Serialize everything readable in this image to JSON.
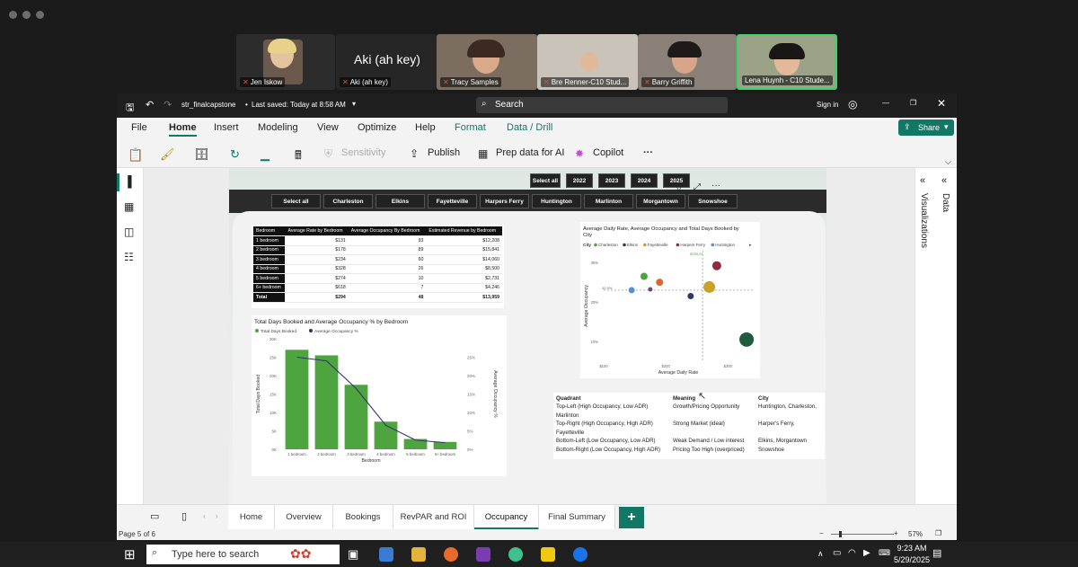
{
  "meeting": {
    "participants": [
      {
        "name": "Jen Iskow"
      },
      {
        "name": "Aki (ah key)",
        "big_label": "Aki (ah key)"
      },
      {
        "name": "Tracy Samples"
      },
      {
        "name": "Bre Renner-C10 Stud..."
      },
      {
        "name": "Barry Griffith"
      },
      {
        "name": "Lena Huynh - C10 Stude..."
      }
    ]
  },
  "app": {
    "file_title": "str_finalcapstone",
    "saved": "Last saved: Today at 8:58 AM",
    "search_placeholder": "Search",
    "sign_in": "Sign in",
    "menu": [
      "File",
      "Home",
      "Insert",
      "Modeling",
      "View",
      "Optimize",
      "Help",
      "Format",
      "Data / Drill"
    ],
    "share": "Share",
    "ribbon": {
      "sensitivity": "Sensitivity",
      "publish": "Publish",
      "prep": "Prep data for AI",
      "copilot": "Copilot",
      "more": "···"
    },
    "right_panes": [
      "Visualizations",
      "Data"
    ],
    "accent": "#117865"
  },
  "report": {
    "year_slicer": [
      "Select all",
      "2022",
      "2023",
      "2024",
      "2025"
    ],
    "city_slicer": [
      "Select all",
      "Charleston",
      "Elkins",
      "Fayetteville",
      "Harpers Ferry",
      "Huntington",
      "Marlinton",
      "Morgantown",
      "Snowshoe"
    ],
    "table": {
      "headers": [
        "Bedroom",
        "Average Rate by Bedroom",
        "Average Occupancy By Bedroom",
        "Estimated Revenue by Bedroom"
      ],
      "rows": [
        [
          "1 bedroom",
          "$131",
          "93",
          "$12,208"
        ],
        [
          "2 bedroom",
          "$178",
          "89",
          "$15,841"
        ],
        [
          "3 bedroom",
          "$234",
          "60",
          "$14,060"
        ],
        [
          "4 bedroom",
          "$328",
          "26",
          "$8,500"
        ],
        [
          "5 bedroom",
          "$274",
          "10",
          "$2,731"
        ],
        [
          "6+ bedroom",
          "$618",
          "7",
          "$4,246"
        ]
      ],
      "total": [
        "Total",
        "$294",
        "48",
        "$13,959"
      ]
    },
    "legend_table": {
      "headers": [
        "Quadrant",
        "Meaning",
        "City"
      ],
      "rows": [
        [
          "Top-Left (High Occupancy, Low ADR)",
          "Growth/Pricing Opportunity",
          "Huntington, Charleston,"
        ],
        [
          "Marlinton",
          "",
          ""
        ],
        [
          "Top-Right (High Occupancy, High ADR)",
          "Strong Market (ideal)",
          "Harper's Ferry,"
        ],
        [
          "Fayetteville",
          "",
          ""
        ],
        [
          "Bottom-Left (Low Occupancy, Low ADR)",
          "Weak Demand / Low interest",
          "Elkins, Morgantown"
        ],
        [
          "Bottom-Right (Low Occupancy, High ADR)",
          "Pricing Too High (overpriced)",
          "Snowshoe"
        ]
      ]
    },
    "tabs": [
      "Home",
      "Overview",
      "Bookings",
      "RevPAR and ROI",
      "Occupancy",
      "Final Summary"
    ],
    "active_tab": "Occupancy",
    "page_status": "Page 5 of 6",
    "zoom": "57%"
  },
  "chart_data": [
    {
      "type": "bar",
      "title": "Total Days Booked and Average Occupancy % by Bedroom",
      "legend": [
        "Total Days Booked",
        "Average Occupancy %"
      ],
      "categories": [
        "1 bedroom",
        "2 bedroom",
        "3 bedroom",
        "4 bedroom",
        "5 bedroom",
        "6+ bedroom"
      ],
      "series": [
        {
          "name": "Total Days Booked",
          "values": [
            27000,
            25500,
            17500,
            7500,
            2800,
            2000
          ],
          "color": "#4ea43f"
        },
        {
          "name": "Average Occupancy %",
          "values": [
            25,
            24,
            16.5,
            6.5,
            2.5,
            1.8
          ],
          "color": "#3a2f6b",
          "axis": "right"
        }
      ],
      "xlabel": "Bedroom",
      "ylabel": "Total Days Booked",
      "y2label": "Average Occupancy %",
      "yticks": [
        "0K",
        "5K",
        "10K",
        "15K",
        "20K",
        "25K",
        "30K"
      ],
      "y2ticks": [
        "0%",
        "5%",
        "10%",
        "15%",
        "20%",
        "25%"
      ],
      "ylim": [
        0,
        30000
      ],
      "y2lim": [
        0,
        30
      ]
    },
    {
      "type": "scatter",
      "title": "Average Daily Rate, Average Occupancy and Total Days Booked by City",
      "legend_label": "City",
      "legend": [
        "Charleston",
        "Elkins",
        "Fayetteville",
        "Harpers Ferry",
        "Huntington"
      ],
      "xlabel": "Average Daily Rate",
      "ylabel": "Average Occupancy",
      "xticks": [
        "$100",
        "$200",
        "$300"
      ],
      "yticks": [
        "30%",
        "20%",
        "10%"
      ],
      "ref_x_label": "$259.24",
      "ref_y_label": "40.9%",
      "xlim": [
        100,
        340
      ],
      "ylim": [
        0.05,
        0.33
      ],
      "points": [
        {
          "name": "Charleston",
          "x": 165,
          "y": 0.265,
          "r": 4,
          "color": "#4ea43f"
        },
        {
          "name": "Harpers Ferry",
          "x": 282,
          "y": 0.292,
          "r": 5,
          "color": "#8e2d3c"
        },
        {
          "name": "Fayetteville",
          "x": 190,
          "y": 0.25,
          "r": 4,
          "color": "#e0642f"
        },
        {
          "name": "Fayetteville-2",
          "x": 270,
          "y": 0.238,
          "r": 6.5,
          "color": "#c9a227"
        },
        {
          "name": "Huntington",
          "x": 145,
          "y": 0.23,
          "r": 3.5,
          "color": "#5b8ed6"
        },
        {
          "name": "Elkins",
          "x": 175,
          "y": 0.232,
          "r": 2.5,
          "color": "#6b4a8a"
        },
        {
          "name": "Morgantown",
          "x": 240,
          "y": 0.215,
          "r": 3.5,
          "color": "#2d3a66"
        },
        {
          "name": "Snowshoe",
          "x": 330,
          "y": 0.105,
          "r": 8,
          "color": "#1f5c3d"
        }
      ]
    }
  ]
}
